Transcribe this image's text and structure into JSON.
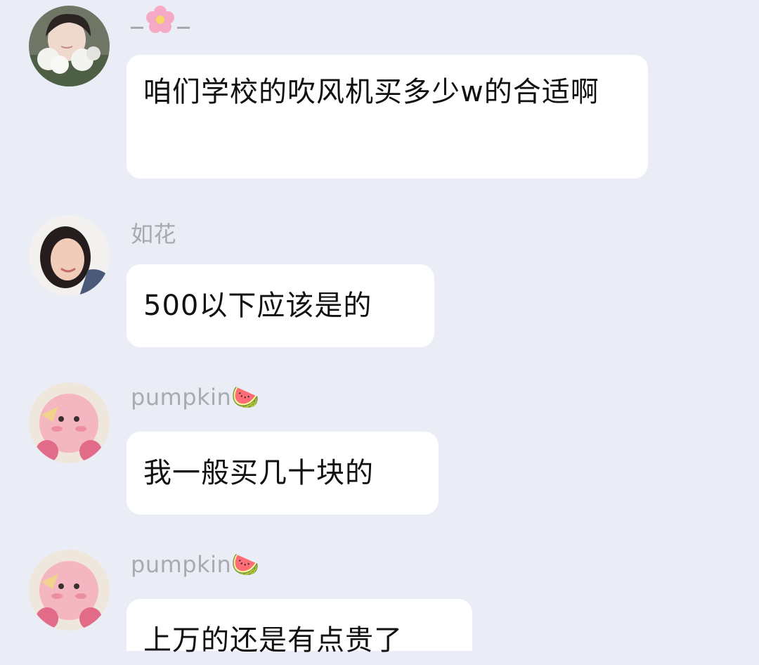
{
  "messages": [
    {
      "sender": "_🌸_",
      "sender_name_visual": "underscore-flower-underscore",
      "avatar": "girl-with-cotton-flowers-avatar",
      "text": "咱们学校的吹风机买多少w的合适啊"
    },
    {
      "sender": "如花",
      "avatar": "smiling-girl-avatar",
      "text": "500以下应该是的"
    },
    {
      "sender": "pumpkin🍉",
      "avatar": "pink-plush-kirby-avatar",
      "text": "我一般买几十块的"
    },
    {
      "sender": "pumpkin🍉",
      "avatar": "pink-plush-kirby-avatar",
      "text": "上万的还是有点贵了"
    }
  ],
  "colors": {
    "background": "#ebedf6",
    "bubble": "#ffffff",
    "sender_text": "#a8aab2",
    "message_text": "#111111"
  },
  "icons": [
    "cherry-blossom-icon",
    "watermelon-icon"
  ]
}
